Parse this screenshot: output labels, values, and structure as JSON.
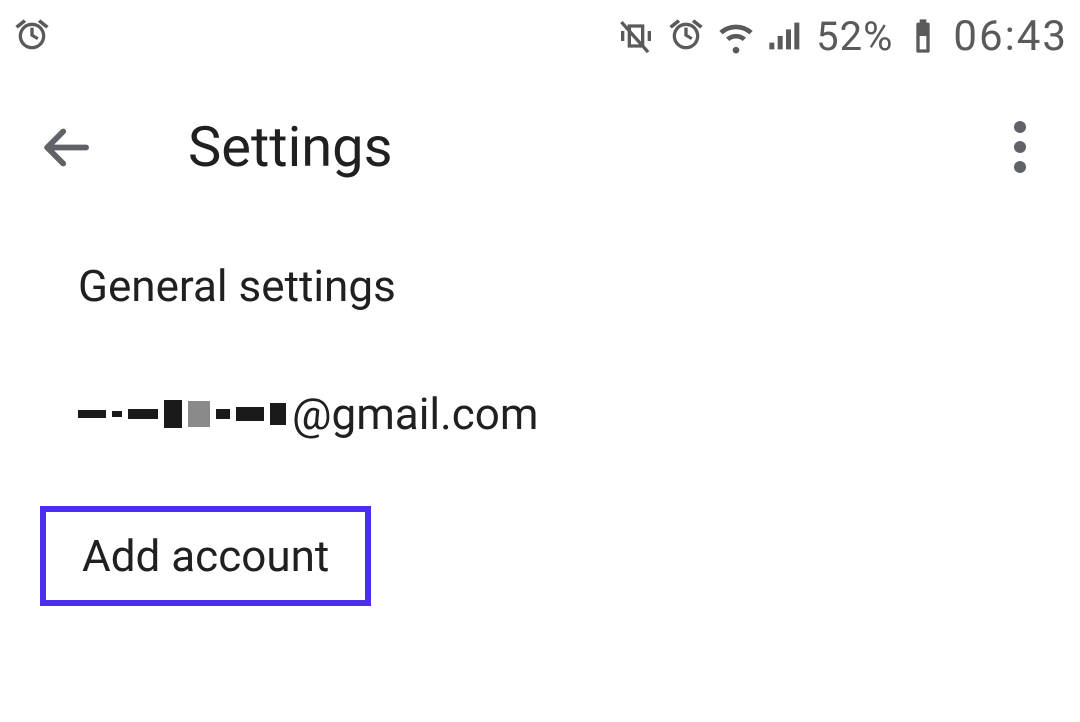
{
  "status": {
    "battery_percent": "52%",
    "time": "06:43"
  },
  "header": {
    "title": "Settings"
  },
  "list": {
    "general": "General settings",
    "account_domain": "@gmail.com",
    "add_account": "Add account"
  }
}
